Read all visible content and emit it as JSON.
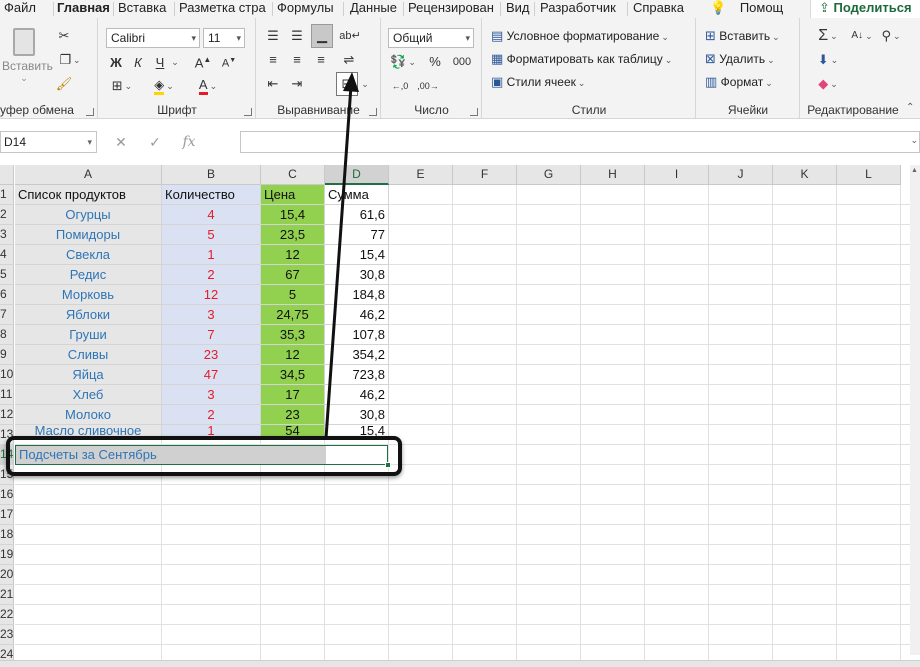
{
  "tabs": [
    {
      "label": "Файл",
      "active": false
    },
    {
      "label": "Главная",
      "active": true
    },
    {
      "label": "Вставка",
      "active": false
    },
    {
      "label": "Разметка стра",
      "active": false
    },
    {
      "label": "Формулы",
      "active": false
    },
    {
      "label": "Данные",
      "active": false
    },
    {
      "label": "Рецензирован",
      "active": false
    },
    {
      "label": "Вид",
      "active": false
    },
    {
      "label": "Разработчик",
      "active": false
    },
    {
      "label": "Справка",
      "active": false
    }
  ],
  "help_label": "Помощ",
  "share_label": "Поделиться",
  "ribbon": {
    "clipboard": {
      "paste_label": "Вставить",
      "group_label": "уфер обмена"
    },
    "font": {
      "font_name": "Calibri",
      "font_size": "11",
      "group_label": "Шрифт",
      "bold": "Ж",
      "italic": "К",
      "underline": "Ч"
    },
    "alignment": {
      "group_label": "Выравнивание"
    },
    "number": {
      "format": "Общий",
      "group_label": "Число"
    },
    "styles": {
      "conditional": "Условное форматирование",
      "format_table": "Форматировать как таблицу",
      "cell_styles": "Стили ячеек",
      "group_label": "Стили"
    },
    "cells": {
      "insert": "Вставить",
      "delete": "Удалить",
      "format": "Формат",
      "group_label": "Ячейки"
    },
    "editing": {
      "group_label": "Редактирование"
    }
  },
  "formula_bar": {
    "name_box": "D14",
    "cancel": "✕",
    "enter": "✓",
    "fx": "fx"
  },
  "columns": [
    "A",
    "B",
    "C",
    "D",
    "E",
    "F",
    "G",
    "H",
    "I",
    "J",
    "K",
    "L"
  ],
  "rows": [
    "1",
    "2",
    "3",
    "4",
    "5",
    "6",
    "7",
    "8",
    "9",
    "10",
    "11",
    "12",
    "13",
    "14",
    "15",
    "16",
    "17",
    "18",
    "19",
    "20",
    "21",
    "22",
    "23",
    "24"
  ],
  "header_row": {
    "a": "Список продуктов",
    "b": "Количество",
    "c": "Цена",
    "d": "Сумма"
  },
  "data_rows": [
    {
      "a": "Огурцы",
      "b": "4",
      "c": "15,4",
      "d": "61,6"
    },
    {
      "a": "Помидоры",
      "b": "5",
      "c": "23,5",
      "d": "77"
    },
    {
      "a": "Свекла",
      "b": "1",
      "c": "12",
      "d": "15,4"
    },
    {
      "a": "Редис",
      "b": "2",
      "c": "67",
      "d": "30,8"
    },
    {
      "a": "Морковь",
      "b": "12",
      "c": "5",
      "d": "184,8"
    },
    {
      "a": "Яблоки",
      "b": "3",
      "c": "24,75",
      "d": "46,2"
    },
    {
      "a": "Груши",
      "b": "7",
      "c": "35,3",
      "d": "107,8"
    },
    {
      "a": "Сливы",
      "b": "23",
      "c": "12",
      "d": "354,2"
    },
    {
      "a": "Яйца",
      "b": "47",
      "c": "34,5",
      "d": "723,8"
    },
    {
      "a": "Хлеб",
      "b": "3",
      "c": "17",
      "d": "46,2"
    },
    {
      "a": "Молоко",
      "b": "2",
      "c": "23",
      "d": "30,8"
    },
    {
      "a": "Масло сливочное",
      "b": "1",
      "c": "54",
      "d": "15,4"
    }
  ],
  "merged_row": {
    "text": "Подсчеты за Сентябрь"
  },
  "colors": {
    "col_a": "#e7e6e6",
    "col_b": "#d9e1f2",
    "col_c": "#92d050",
    "text_blue": "#2e75b6",
    "text_red": "#e51c23",
    "accent": "#1f7145"
  }
}
